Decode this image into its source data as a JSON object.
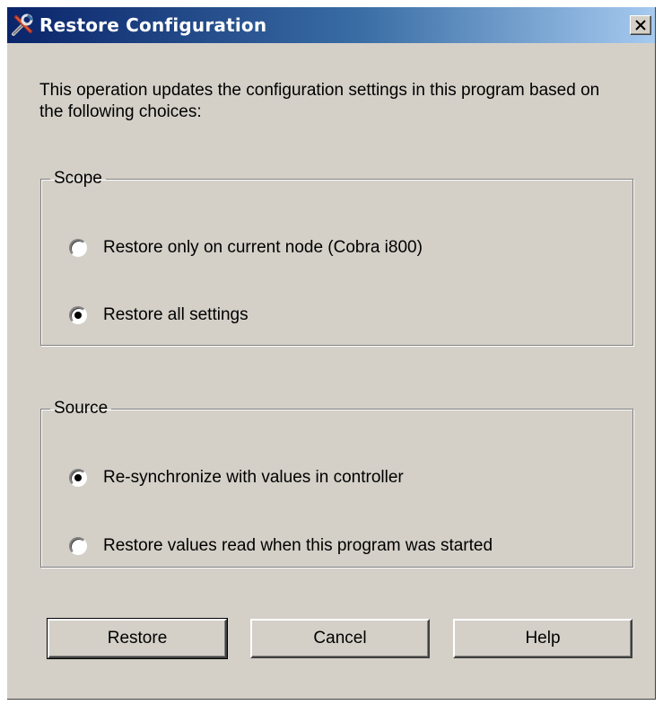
{
  "window": {
    "title": "Restore Configuration",
    "title_icon": "tools-icon",
    "close_glyph": "×"
  },
  "intro_text": "This operation updates the configuration settings in this program based on the following choices:",
  "scope": {
    "legend": "Scope",
    "options": [
      {
        "label": "Restore only on current node (Cobra i800)",
        "checked": false
      },
      {
        "label": "Restore all settings",
        "checked": true
      }
    ]
  },
  "source": {
    "legend": "Source",
    "options": [
      {
        "label": "Re-synchronize with values in controller",
        "checked": true
      },
      {
        "label": "Restore values read when this program was started",
        "checked": false
      }
    ]
  },
  "buttons": {
    "restore": "Restore",
    "cancel": "Cancel",
    "help": "Help"
  },
  "colors": {
    "dialog_face": "#d4d0c8",
    "title_gradient_start": "#0a246a",
    "title_gradient_end": "#a6caf0"
  }
}
